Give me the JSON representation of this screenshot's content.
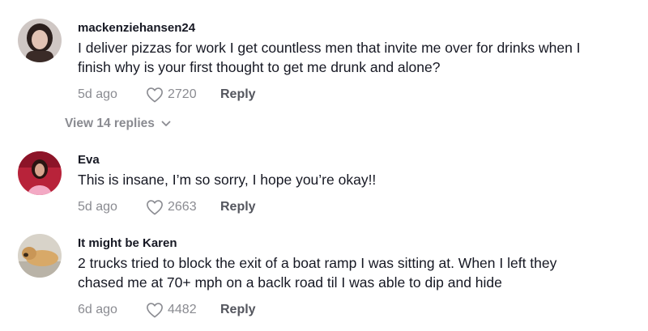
{
  "comments": [
    {
      "username": "mackenziehansen24",
      "text_lines": [
        "I deliver pizzas for work I get countless men that invite me over for drinks when I",
        "finish why is your first thought to get me drunk and alone?"
      ],
      "time": "5d ago",
      "likes": "2720",
      "reply_label": "Reply",
      "view_replies": "View 14 replies"
    },
    {
      "username": "Eva",
      "text_lines": [
        "This is insane, I’m so sorry, I hope you’re okay!!"
      ],
      "time": "5d ago",
      "likes": "2663",
      "reply_label": "Reply"
    },
    {
      "username": "It might be Karen",
      "text_lines": [
        "2 trucks tried to block the exit of a boat ramp I was sitting at. When I left they",
        "chased me at 70+ mph on a baclk road til I was able to dip and hide"
      ],
      "time": "6d ago",
      "likes": "4482",
      "reply_label": "Reply"
    }
  ],
  "icons": {
    "like": "heart-outline-icon",
    "expand": "chevron-down-icon"
  },
  "colors": {
    "text": "#161823",
    "muted": "#8a8b91",
    "reply": "#54565e"
  }
}
